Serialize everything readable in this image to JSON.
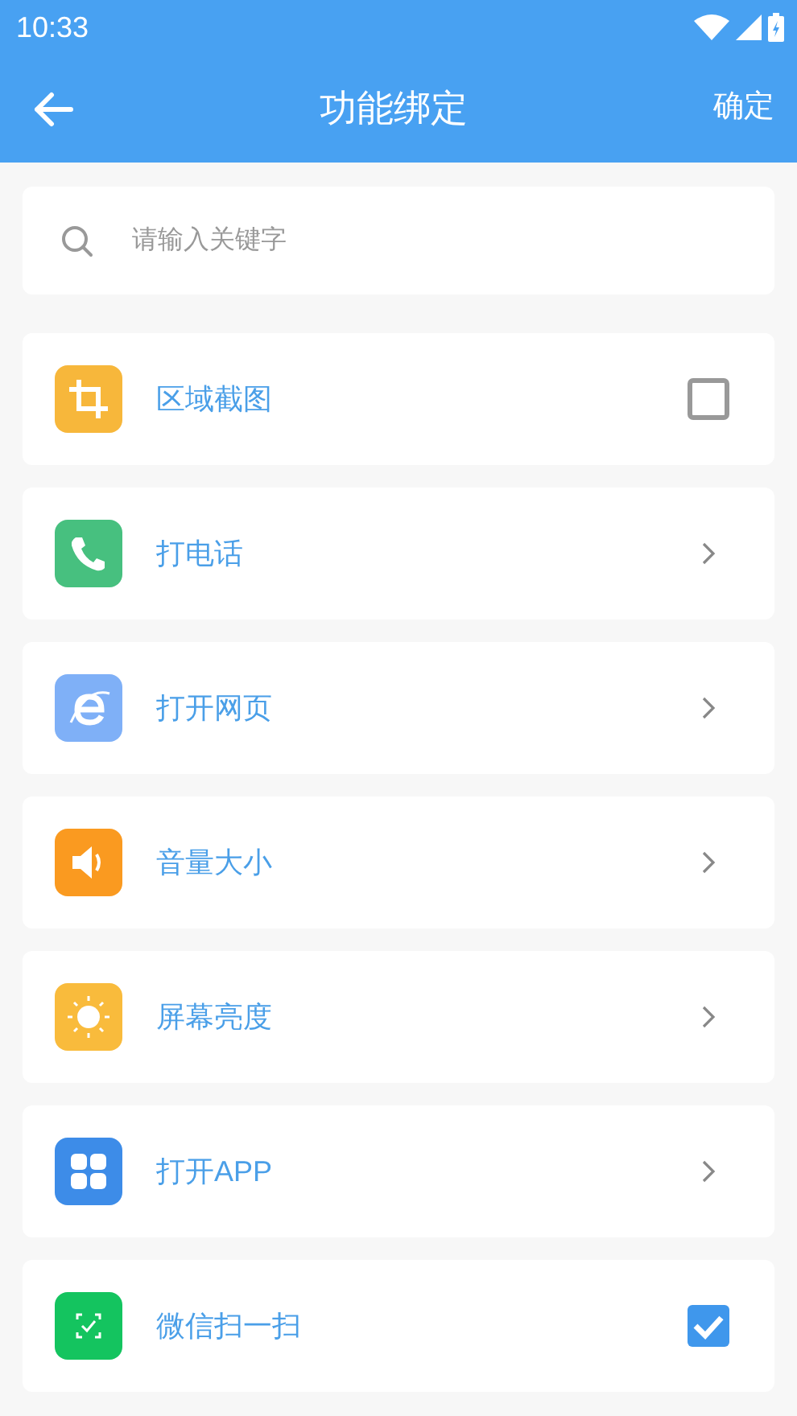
{
  "status_bar": {
    "time": "10:33"
  },
  "app_bar": {
    "title": "功能绑定",
    "action": "确定"
  },
  "search": {
    "placeholder": "请输入关键字"
  },
  "items": [
    {
      "label": "区域截图",
      "color": "#f7b73b",
      "kind": "checkbox",
      "checked": false
    },
    {
      "label": "打电话",
      "color": "#47c07f",
      "kind": "link"
    },
    {
      "label": "打开网页",
      "color": "#7fb0f7",
      "kind": "link"
    },
    {
      "label": "音量大小",
      "color": "#fa9a20",
      "kind": "link"
    },
    {
      "label": "屏幕亮度",
      "color": "#f9bb3c",
      "kind": "link"
    },
    {
      "label": "打开APP",
      "color": "#3d8ce8",
      "kind": "link"
    },
    {
      "label": "微信扫一扫",
      "color": "#14c45f",
      "kind": "checkbox",
      "checked": true
    }
  ]
}
